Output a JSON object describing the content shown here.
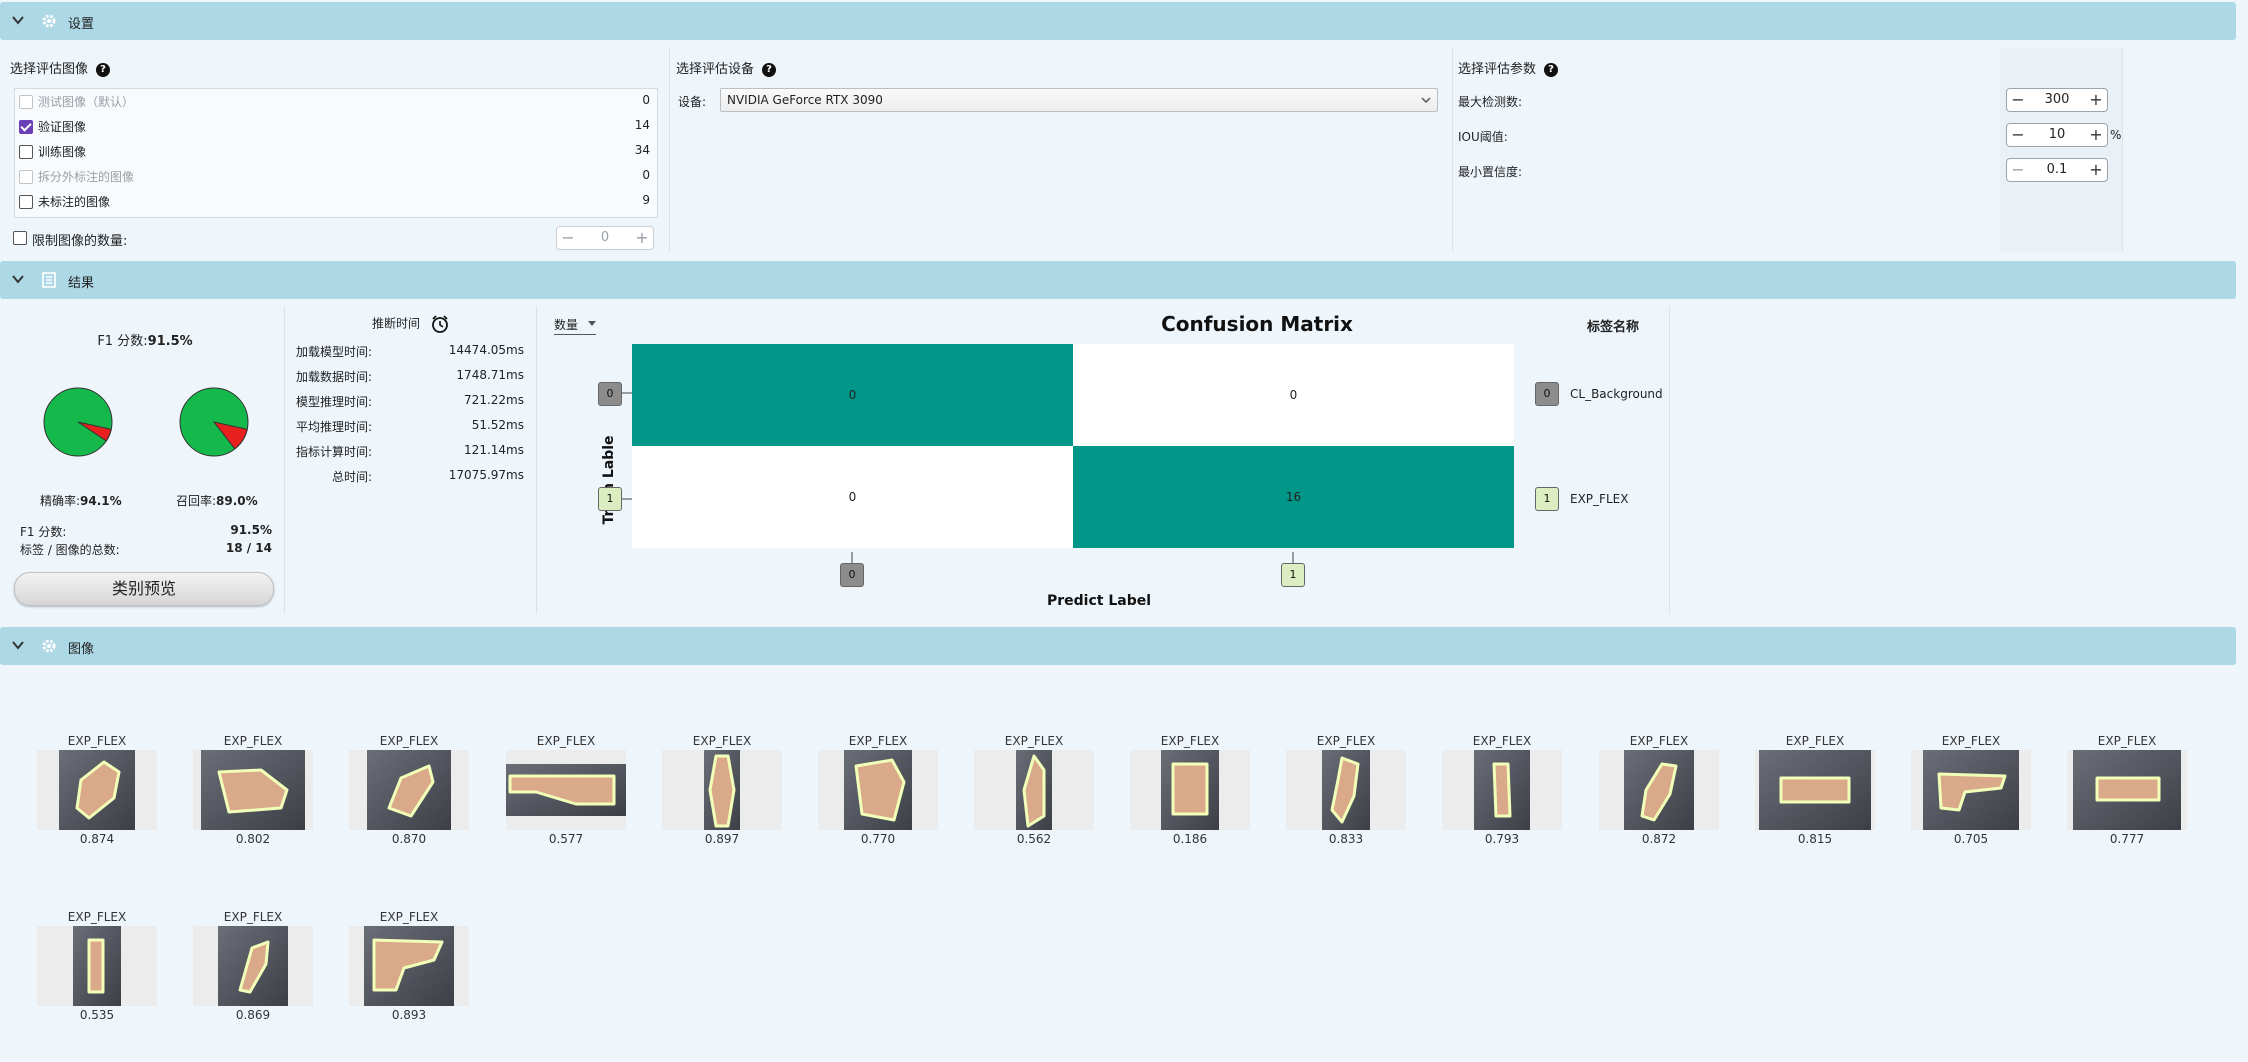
{
  "settings_bar": {
    "title": "设置",
    "icon": "gear-icon"
  },
  "image_select": {
    "label": "选择评估图像",
    "items": [
      {
        "label": "测试图像（默认）",
        "count": "0",
        "checked": false,
        "disabled": true
      },
      {
        "label": "验证图像",
        "count": "14",
        "checked": true,
        "disabled": false
      },
      {
        "label": "训练图像",
        "count": "34",
        "checked": false,
        "disabled": false
      },
      {
        "label": "拆分外标注的图像",
        "count": "0",
        "checked": false,
        "disabled": true
      },
      {
        "label": "未标注的图像",
        "count": "9",
        "checked": false,
        "disabled": false
      }
    ],
    "limit_label": "限制图像的数量:",
    "limit_value": "0"
  },
  "device_select": {
    "label": "选择评估设备",
    "device_label": "设备:",
    "device_value": "NVIDIA GeForce RTX 3090"
  },
  "params": {
    "label": "选择评估参数",
    "max_det_label": "最大检测数:",
    "max_det_value": "300",
    "iou_label": "IOU阈值:",
    "iou_value": "10",
    "iou_unit": "%",
    "min_conf_label": "最小置信度:",
    "min_conf_value": "0.1"
  },
  "results_bar": {
    "title": "结果",
    "icon": "clipboard-icon"
  },
  "metrics": {
    "f1_title_label": "F1 分数:",
    "f1_title_value": "91.5%",
    "precision_label": "精确率:",
    "precision_value": "94.1%",
    "recall_label": "召回率:",
    "recall_value": "89.0%",
    "precision_fraction": 0.941,
    "recall_fraction": 0.89,
    "f1_label": "F1 分数:",
    "f1_value": "91.5%",
    "total_label": "标签 / 图像的总数:",
    "total_value": "18 / 14",
    "preview_button": "类别预览"
  },
  "timing": {
    "title": "推断时间",
    "rows": [
      {
        "label": "加载模型时间:",
        "value": "14474.05",
        "unit": "ms"
      },
      {
        "label": "加载数据时间:",
        "value": "1748.71",
        "unit": "ms"
      },
      {
        "label": "模型推理时间:",
        "value": "721.22",
        "unit": "ms"
      },
      {
        "label": "平均推理时间:",
        "value": "51.52",
        "unit": "ms"
      },
      {
        "label": "指标计算时间:",
        "value": "121.14",
        "unit": "ms"
      },
      {
        "label": "总时间:",
        "value": "17075.97",
        "unit": "ms"
      }
    ]
  },
  "matrix": {
    "mode_select": "数量",
    "title": "Confusion  Matrix",
    "ylabel": "Truth  Lable",
    "xlabel": "Predict  Label",
    "legend_title": "标签名称",
    "classes": [
      {
        "id": "0",
        "name": "CL_Background"
      },
      {
        "id": "1",
        "name": "EXP_FLEX"
      }
    ],
    "cells": [
      [
        "0",
        "0"
      ],
      [
        "0",
        "16"
      ]
    ],
    "colors": {
      "diag": "#009688",
      "off": "#ffffff",
      "class0": "#8c8c8c",
      "class1": "#dcedc2"
    }
  },
  "images_bar": {
    "title": "图像",
    "icon": "gear-icon"
  },
  "images": [
    {
      "label": "EXP_FLEX",
      "score": "0.874"
    },
    {
      "label": "EXP_FLEX",
      "score": "0.802"
    },
    {
      "label": "EXP_FLEX",
      "score": "0.870"
    },
    {
      "label": "EXP_FLEX",
      "score": "0.577"
    },
    {
      "label": "EXP_FLEX",
      "score": "0.897"
    },
    {
      "label": "EXP_FLEX",
      "score": "0.770"
    },
    {
      "label": "EXP_FLEX",
      "score": "0.562"
    },
    {
      "label": "EXP_FLEX",
      "score": "0.186"
    },
    {
      "label": "EXP_FLEX",
      "score": "0.833"
    },
    {
      "label": "EXP_FLEX",
      "score": "0.793"
    },
    {
      "label": "EXP_FLEX",
      "score": "0.872"
    },
    {
      "label": "EXP_FLEX",
      "score": "0.815"
    },
    {
      "label": "EXP_FLEX",
      "score": "0.705"
    },
    {
      "label": "EXP_FLEX",
      "score": "0.777"
    },
    {
      "label": "EXP_FLEX",
      "score": "0.535"
    },
    {
      "label": "EXP_FLEX",
      "score": "0.869"
    },
    {
      "label": "EXP_FLEX",
      "score": "0.893"
    }
  ]
}
